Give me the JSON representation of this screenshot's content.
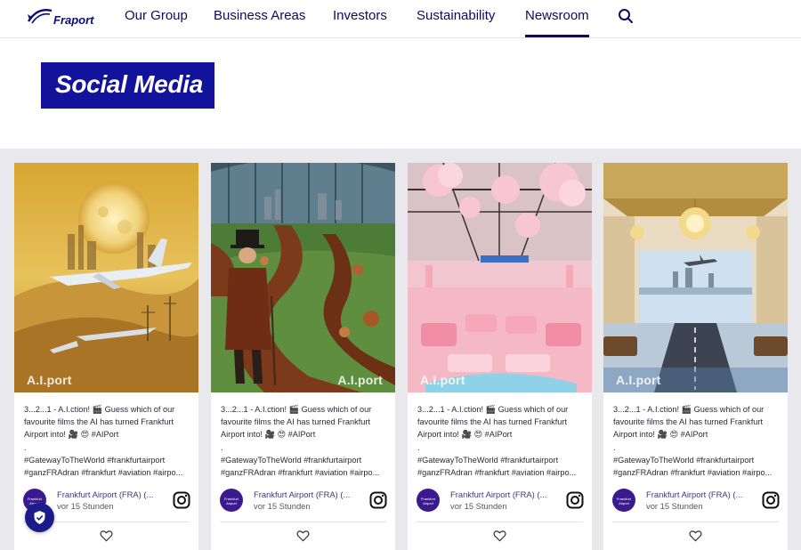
{
  "header": {
    "logo_text": "Fraport",
    "nav": [
      {
        "label": "Our Group"
      },
      {
        "label": "Business Areas"
      },
      {
        "label": "Investors"
      },
      {
        "label": "Sustainability"
      },
      {
        "label": "Newsroom",
        "active": true
      }
    ],
    "search_icon": "search-icon"
  },
  "section": {
    "title": "Social Media",
    "title_bg": "#12129a"
  },
  "posts": [
    {
      "watermark": "A.I.port",
      "lines": [
        "3...2...1 - A.I.ction! 🎬 Guess which of our",
        "favourite films the AI has turned Frankfurt",
        "Airport into! 🎥 😍 #AIPort",
        ".",
        "#GatewayToTheWorld #frankfurtairport",
        "#ganzFRAdran #frankfurt #aviation #airpo..."
      ],
      "author": "Frankfurt Airport (FRA) (...",
      "time": "vor 15 Stunden"
    },
    {
      "watermark": "A.I.port",
      "lines": [
        "3...2...1 - A.I.ction! 🎬 Guess which of our",
        "favourite films the AI has turned Frankfurt",
        "Airport into! 🎥 😍 #AIPort",
        ".",
        "#GatewayToTheWorld #frankfurtairport",
        "#ganzFRAdran #frankfurt #aviation #airpo..."
      ],
      "author": "Frankfurt Airport (FRA) (...",
      "time": "vor 15 Stunden"
    },
    {
      "watermark": "A.I.port",
      "lines": [
        "3...2...1 - A.I.ction! 🎬 Guess which of our",
        "favourite films the AI has turned Frankfurt",
        "Airport into! 🎥 😍 #AIPort",
        ".",
        "#GatewayToTheWorld #frankfurtairport",
        "#ganzFRAdran #frankfurt #aviation #airpo..."
      ],
      "author": "Frankfurt Airport (FRA) (...",
      "time": "vor 15 Stunden"
    },
    {
      "watermark": "A.I.port",
      "lines": [
        "3...2...1 - A.I.ction! 🎬 Guess which of our",
        "favourite films the AI has turned Frankfurt",
        "Airport into! 🎥 😍 #AIPort",
        ".",
        "#GatewayToTheWorld #frankfurtairport",
        "#ganzFRAdran #frankfurt #aviation #airpo..."
      ],
      "author": "Frankfurt Airport (FRA) (...",
      "time": "vor 15 Stunden"
    }
  ],
  "colors": {
    "brand": "#0b0b5e",
    "feed_bg": "#e9e9ed",
    "avatar": "#3b1a8f"
  }
}
